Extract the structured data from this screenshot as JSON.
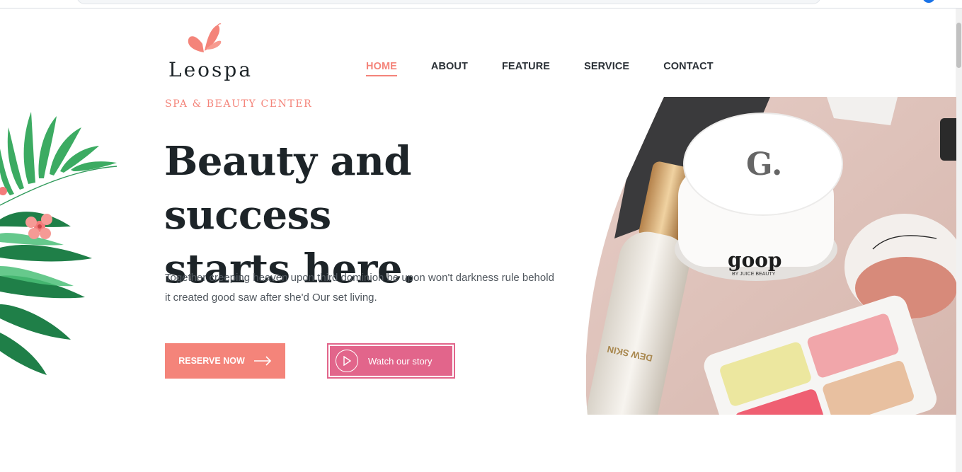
{
  "brand": {
    "name": "Leospa",
    "accent": "#f4847a",
    "secondary_accent": "#e2658b",
    "logo_icon": "butterfly-icon"
  },
  "nav": {
    "items": [
      {
        "label": "HOME",
        "active": true
      },
      {
        "label": "ABOUT",
        "active": false
      },
      {
        "label": "FEATURE",
        "active": false
      },
      {
        "label": "SERVICE",
        "active": false
      },
      {
        "label": "CONTACT",
        "active": false
      }
    ]
  },
  "hero": {
    "eyebrow": "SPA & BEAUTY CENTER",
    "headline_line1": "Beauty and success",
    "headline_line2": "starts here.",
    "description": "Together creeping heaven upon third dominion be upon won't darkness rule behold it created good saw after she'd Our set living.",
    "reserve_label": "RESERVE NOW",
    "reserve_icon": "arrow-right-icon",
    "watch_label": "Watch our story",
    "watch_icon": "play-icon"
  },
  "product_image": {
    "jar_letter": "G.",
    "jar_brand": "goop",
    "jar_sub": "BY JUICE BEAUTY",
    "bottle_text": "DEW SKIN"
  }
}
